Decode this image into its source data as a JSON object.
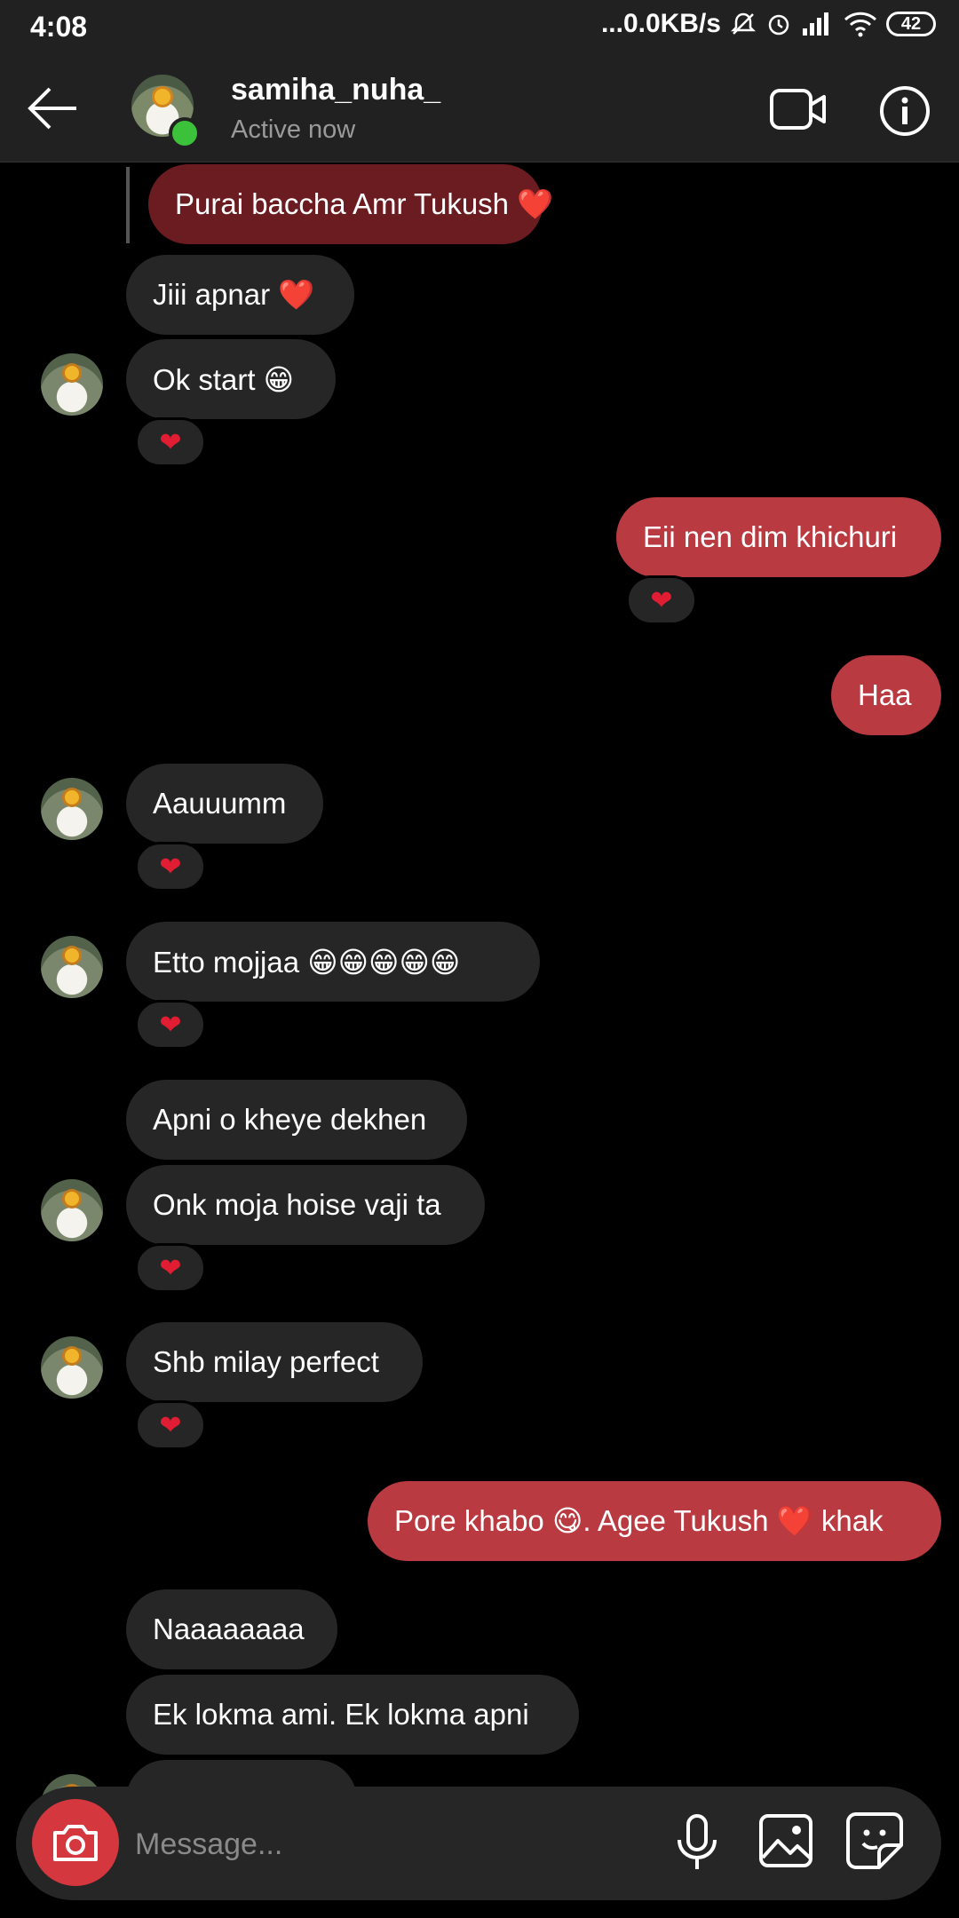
{
  "status_bar": {
    "time": "4:08",
    "network": "...0.0KB/s",
    "battery": "42"
  },
  "header": {
    "username": "samiha_nuha_",
    "status": "Active now"
  },
  "messages": [
    {
      "text": "Purai baccha Amr Tukush ❤️",
      "side": "reply"
    },
    {
      "text": "Jiii apnar ❤️",
      "side": "received"
    },
    {
      "text": "Ok start 😁",
      "side": "received",
      "reaction": "❤"
    },
    {
      "text": "Eii nen dim khichuri",
      "side": "sent",
      "reaction": "❤"
    },
    {
      "text": "Haa",
      "side": "sent"
    },
    {
      "text": "Aauuumm",
      "side": "received",
      "reaction": "❤"
    },
    {
      "text": "Etto mojjaa 😁😁😁😁😁",
      "side": "received",
      "reaction": "❤"
    },
    {
      "text": "Apni o kheye dekhen",
      "side": "received"
    },
    {
      "text": "Onk moja hoise vaji ta",
      "side": "received",
      "reaction": "❤"
    },
    {
      "text": "Shb milay perfect",
      "side": "received",
      "reaction": "❤"
    },
    {
      "text": "Pore khabo 😋. Agee Tukush ❤️ khak",
      "side": "sent"
    },
    {
      "text": "Naaaaaaaa",
      "side": "received"
    },
    {
      "text": "Ek lokma ami. Ek lokma apni",
      "side": "received"
    }
  ],
  "composer": {
    "placeholder": "Message..."
  },
  "colors": {
    "sent_bubble": "#b93a40",
    "received_bubble": "#262626",
    "reply_bubble": "#6b1c21",
    "online": "#3cc13b",
    "heart": "#e11d33"
  }
}
